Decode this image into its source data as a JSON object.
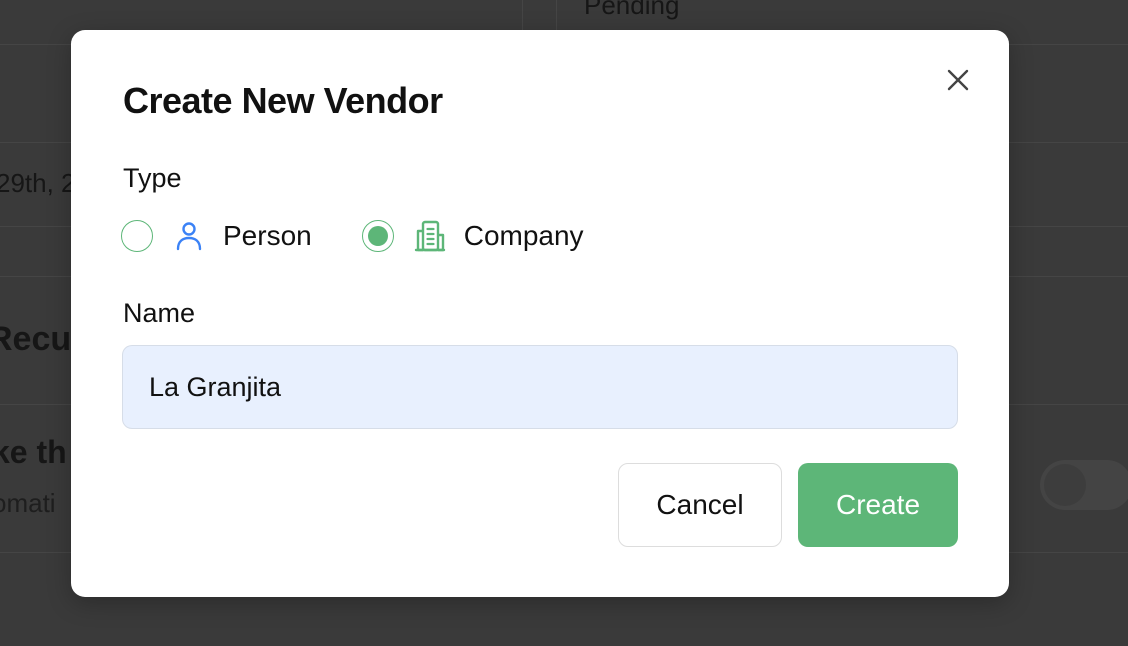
{
  "background": {
    "status_text": "Pending",
    "date_fragment": "29th, 2",
    "section_fragment": "Recu",
    "row_title_fragment": "ke th",
    "row_subtitle_fragment": "omati"
  },
  "modal": {
    "title": "Create New Vendor",
    "close_icon": "close-icon",
    "type_label": "Type",
    "type_options": [
      {
        "label": "Person",
        "icon": "person-icon",
        "icon_color": "#3b82f6",
        "selected": false
      },
      {
        "label": "Company",
        "icon": "building-icon",
        "icon_color": "#5db678",
        "selected": true
      }
    ],
    "name_label": "Name",
    "name_value": "La Granjita",
    "cancel_label": "Cancel",
    "create_label": "Create"
  },
  "colors": {
    "accent": "#5db678",
    "person_icon": "#3b82f6",
    "input_background": "#e8f0fe",
    "overlay": "#3a3a3a"
  }
}
